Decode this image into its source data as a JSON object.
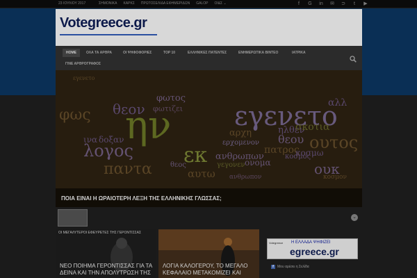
{
  "topbar": {
    "date": "23 ΙΟΥΛΙΟΥ 2017",
    "links": [
      "ΣΗΜΟΝΙΚΑ",
      "ΚΑΡΚΣ",
      "ΠΡΩΤΟΣΕΛΙΔΑ ΕΦΗΜΕΡΙΔΩΝ",
      "GALOP",
      "ΟΙ&Σ"
    ],
    "social": [
      {
        "icon": "facebook-icon",
        "glyph": "f"
      },
      {
        "icon": "google-plus-icon",
        "glyph": "G"
      },
      {
        "icon": "linkedin-icon",
        "glyph": "in"
      },
      {
        "icon": "email-icon",
        "glyph": "✉"
      },
      {
        "icon": "rss-icon",
        "glyph": "⊃"
      },
      {
        "icon": "twitter-icon",
        "glyph": "t"
      },
      {
        "icon": "youtube-icon",
        "glyph": "▶"
      }
    ]
  },
  "header": {
    "logo_main": "Votegreece",
    "logo_tld": ".gr"
  },
  "nav": {
    "items": [
      "HOME",
      "ΟΛΑ ΤΑ ΑΡΘΡΑ",
      "ΟΙ ΨΗΦΟΦΟΡΙΕΣ",
      "TOP 10",
      "ΕΛΛΗΝΙΚΕΣ ΠΑΤΕΝΤΕΣ",
      "ΕΝΗΜΕΡΩΤΙΚΑ ΒΙΝΤΕΟ",
      "ΙΑΤΡΙΚΑ",
      "ΓΙΝΕ ΑΡΘΡΟΓΡΑΦΟΣ"
    ]
  },
  "hero": {
    "title": "ΠΟΙΑ ΕΙΝΑΙ Η ΩΡΑΙΟΤΕΡΗ ΛΕΞΗ ΤΗΣ ΕΛΛΗΝΙΚΗΣ ΓΛΩΣΣΑΣ;",
    "words": [
      "φωτος",
      "θεον",
      "ην",
      "εγενετο",
      "φως",
      "φωτιζει",
      "αρχη",
      "ηλθεν",
      "λογος",
      "εκ",
      "θεου",
      "πατρος",
      "ουτος",
      "παντα",
      "ανθρωπων",
      "σκοτια",
      "κοσμω",
      "αυτω",
      "ουκ",
      "ονομα",
      "ερχομενον",
      "κοσμος",
      "γεγονεν",
      "θεος",
      "ινα",
      "δοξαν",
      "αλλ",
      "κοσμον",
      "εγενετο",
      "ανθρωπον"
    ]
  },
  "cards": [
    {
      "label": "ΟΙ ΜΕΓΑΛΥΤΕΡΟΙ ΕΦΕΥΡΕΤΕΣ ΤΗΣ ΓΕΡΟΝΤΙΣΣΑΣ",
      "title": "ΝΕΟ ΠΟΙΗΜΑ ΓΕΡΟΝΤΙΣΣΑΣ ΓΙΑ ΤΑ ΔΕΙΝΑ ΚΑΙ ΤΗΝ ΑΠΟΛΥΤΡΩΣΗ ΤΗΣ"
    },
    {
      "label": "",
      "title": "ΛΟΓΙΑ ΚΑΛΟΓΕΡΟΥ, ΤΟ ΜΕΓΑΛΟ ΚΕΦΑΛΑΙΟ ΜΕΤΑΚΟΜΙΖΕΙ ΚΑΙ"
    }
  ],
  "widget": {
    "head": "Votegreece",
    "title": "Η ΕΛΛΑΔΑ ΨΗΦΙΖΕΙ",
    "logo": "egreece.gr"
  },
  "fb": {
    "text": "Μου αρέσει η Σελίδα"
  },
  "colors": {
    "brand": "#0d1a4a",
    "blue_band": "#0a2f55",
    "nav_bg": "#2b2b2b"
  }
}
